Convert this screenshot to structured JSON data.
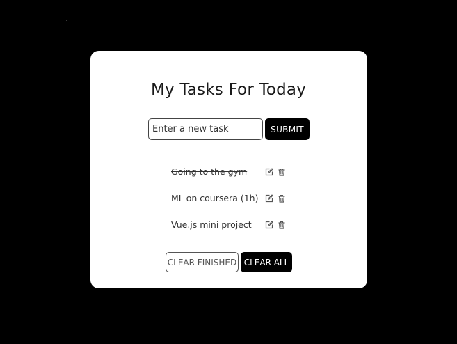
{
  "app": {
    "title": "My Tasks For Today"
  },
  "form": {
    "input_placeholder": "Enter a new task",
    "input_value": "",
    "submit_label": "SUBMIT"
  },
  "tasks": [
    {
      "label": "Going to the gym",
      "completed": true,
      "edit_icon": "edit-icon",
      "delete_icon": "trash-icon"
    },
    {
      "label": "ML on coursera (1h)",
      "completed": false,
      "edit_icon": "edit-icon",
      "delete_icon": "trash-icon"
    },
    {
      "label": "Vue.js mini project",
      "completed": false,
      "edit_icon": "edit-icon",
      "delete_icon": "trash-icon"
    }
  ],
  "actions": {
    "clear_finished_label": "CLEAR FINISHED",
    "clear_all_label": "CLEAR ALL"
  },
  "colors": {
    "background": "#000000",
    "card": "#ffffff",
    "primary_button": "#000000",
    "text": "#333333"
  }
}
